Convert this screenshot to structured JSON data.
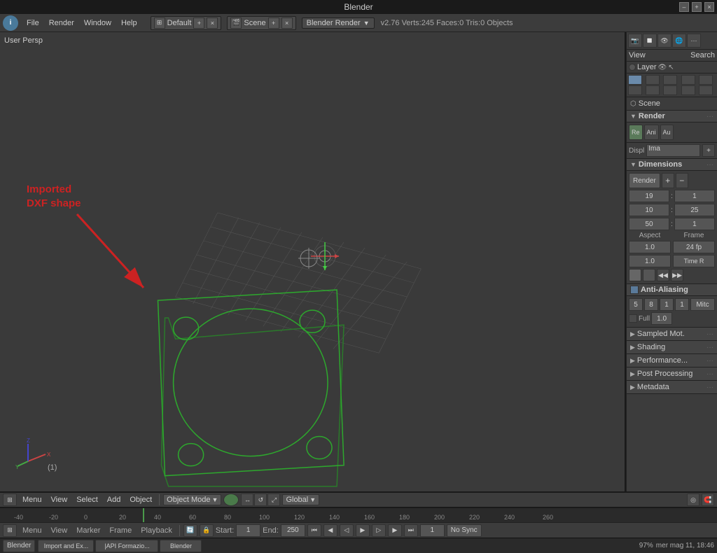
{
  "titlebar": {
    "title": "Blender",
    "controls": {
      "minimize": "–",
      "maximize": "+",
      "close": "×"
    }
  },
  "menubar": {
    "info_icon": "i",
    "items": [
      "File",
      "Render",
      "Window",
      "Help"
    ],
    "workspace": {
      "label": "Default",
      "add": "+",
      "close": "×"
    },
    "scene_selector": {
      "icon": "🎬",
      "label": "Scene",
      "add": "+",
      "close": "×"
    },
    "engine": "Blender Render",
    "version_info": "v2.76  Verts:245  Faces:0  Tris:0  Objects"
  },
  "viewport": {
    "label": "User Persp",
    "annotation": {
      "line1": "Imported",
      "line2": "DXF shape"
    },
    "frame_number": "(1)"
  },
  "right_panel": {
    "view_label": "View",
    "search_label": "Search",
    "layer_label": "Layer",
    "scene_label": "Scene",
    "render_section": "Render",
    "render_icons": [
      "Re",
      "Ani",
      "Au"
    ],
    "disp_label": "Displ",
    "disp_value": "Ima",
    "dimensions_section": "Dimensions",
    "render_btn_label": "Render",
    "resolution": {
      "x": "19",
      "colon1": ":",
      "y": "1",
      "x2": "10",
      "colon2": ":",
      "y2": "25",
      "pct": "50",
      "colon3": ":",
      "scale": "1"
    },
    "aspect_label": "Aspect",
    "frame_label": "Frame",
    "aspect_x": "1.0",
    "aspect_y": "1.0",
    "fps": "24 fp",
    "time_remap": "Time R",
    "anti_aliasing": "Anti-Aliasing",
    "aa_values": [
      "5",
      "8",
      "1",
      "1"
    ],
    "aa_filter": "Mitc",
    "full_label": "Full",
    "full_value": "1.0",
    "shading_section": "Shading",
    "performance_section": "Performance...",
    "post_processing_section": "Post Processing",
    "metadata_section": "Metadata"
  },
  "bottom_toolbar": {
    "mode": "Object Mode",
    "global": "Global",
    "menus": [
      "Menu",
      "View",
      "Select",
      "Add",
      "Object"
    ]
  },
  "timeline": {
    "markers": [
      "-40",
      "-20",
      "0",
      "20",
      "40",
      "60",
      "80",
      "100",
      "120",
      "140",
      "160",
      "180",
      "200",
      "220",
      "240",
      "260"
    ]
  },
  "playback_bar": {
    "menus": [
      "Menu",
      "View",
      "Marker",
      "Frame",
      "Playback"
    ],
    "start_label": "Start:",
    "start_val": "1",
    "end_label": "End:",
    "end_val": "250",
    "current": "1",
    "no_sync": "No Sync"
  },
  "statusbar": {
    "blender_label": "Blender",
    "items": [
      "Import and Ex...",
      "|API Formazio...",
      "Blender"
    ],
    "percent": "97%",
    "clock": "mer mag 11, 18:46"
  }
}
